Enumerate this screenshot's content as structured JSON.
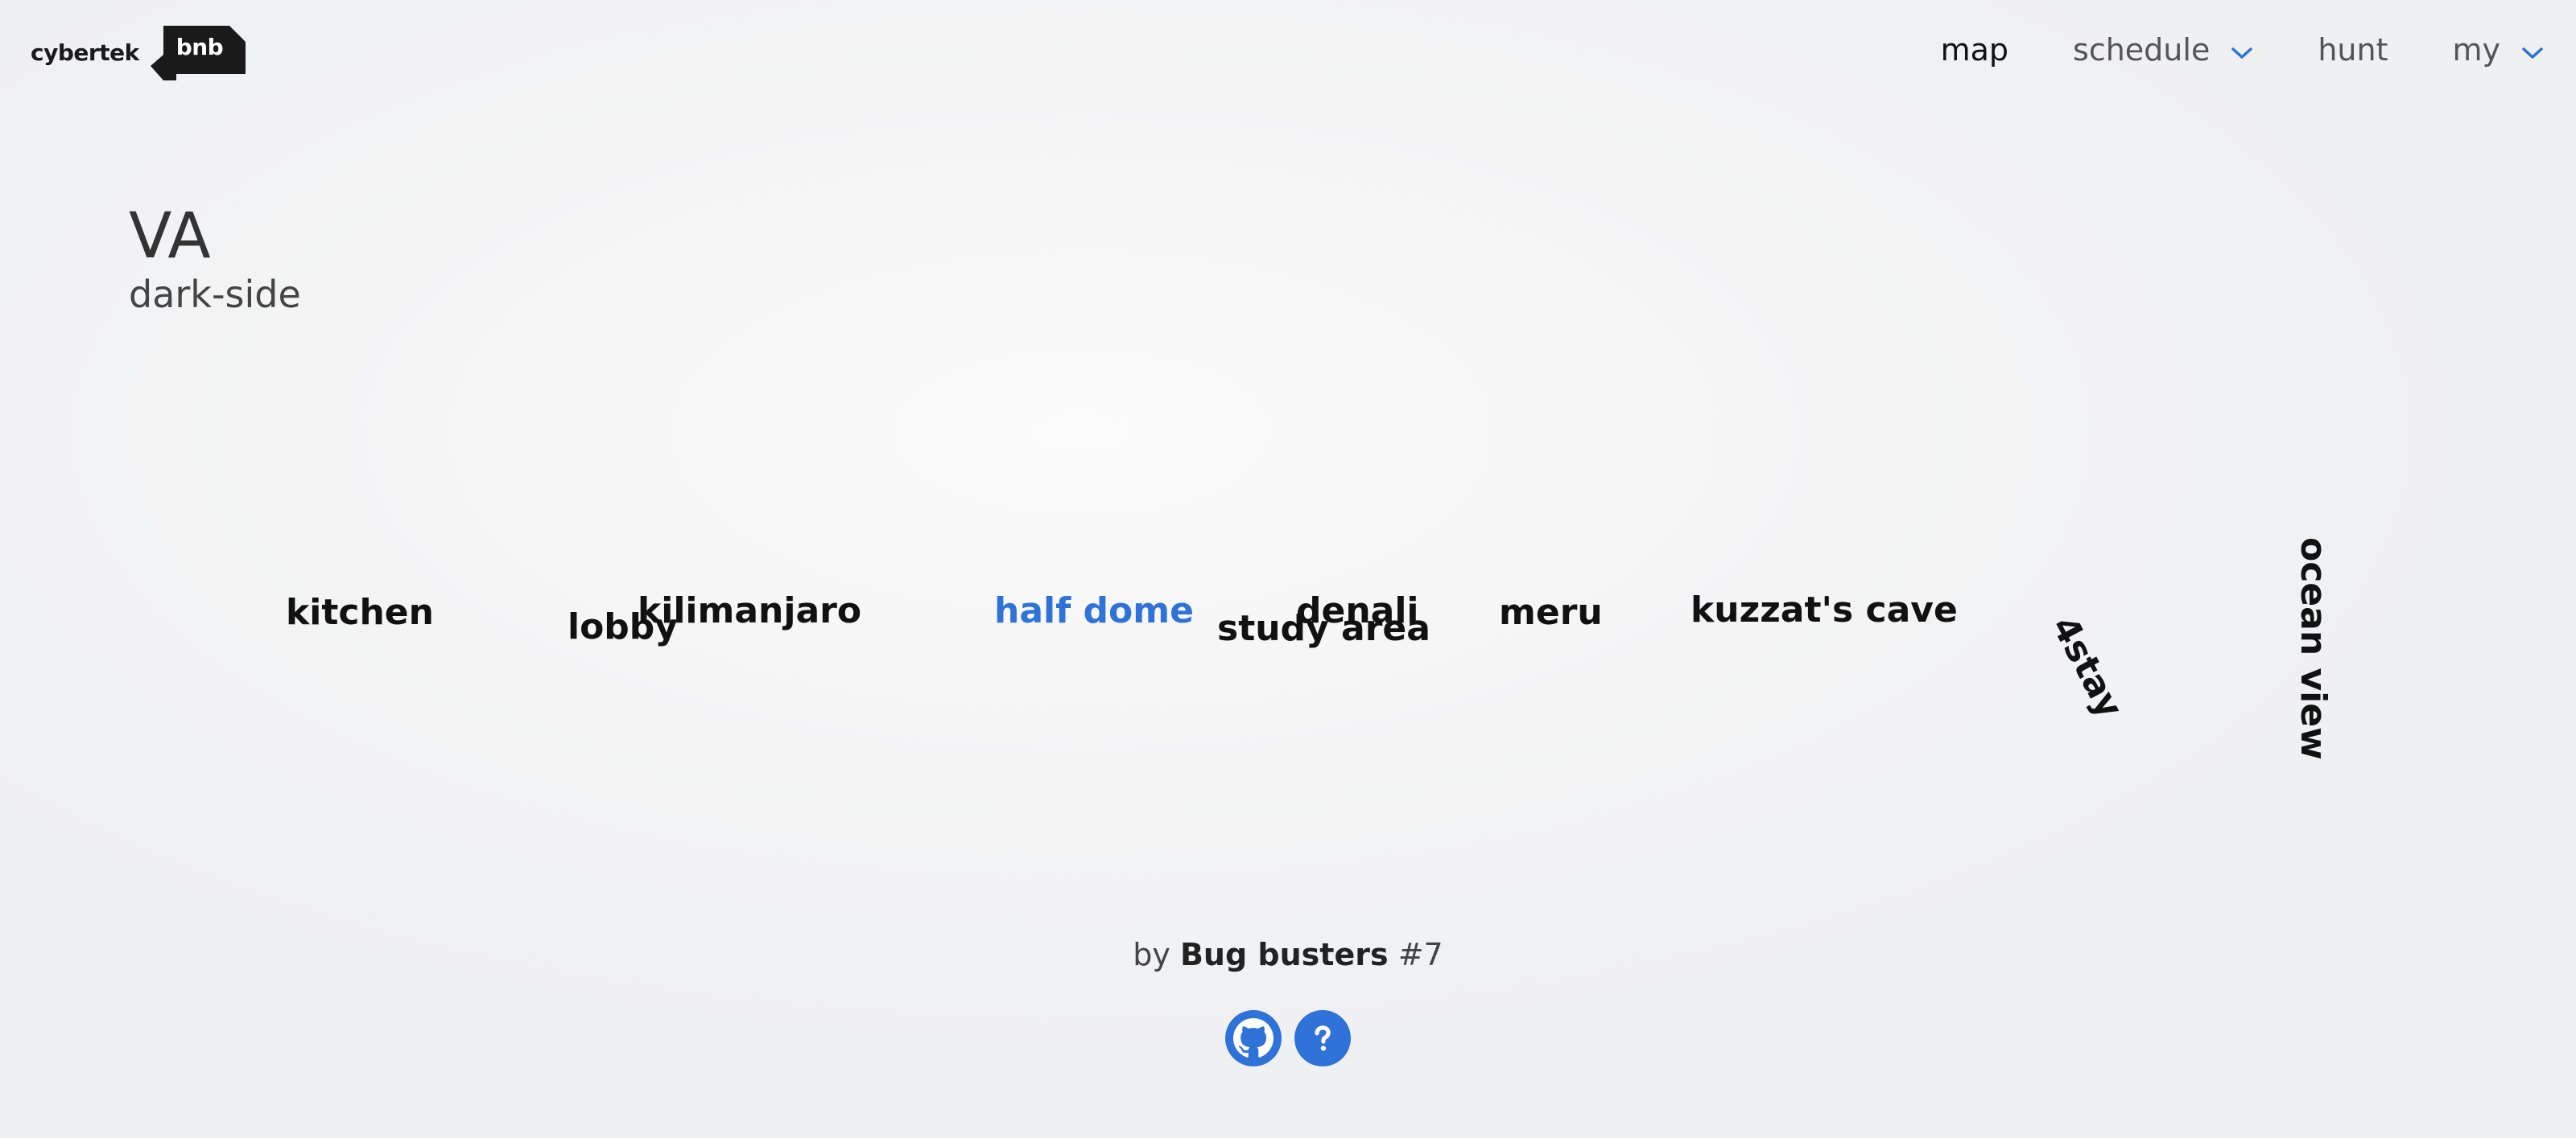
{
  "logo": {
    "word": "cybertek",
    "badge": "bnb"
  },
  "nav": {
    "map": "map",
    "schedule": "schedule",
    "hunt": "hunt",
    "my": "my"
  },
  "page": {
    "title": "VA",
    "subtitle": "dark-side"
  },
  "rooms": {
    "kitchen": "kitchen",
    "lobby": "lobby",
    "kilimanjaro": "kilimanjaro",
    "half_dome": "half dome",
    "study_area": "study area",
    "denali": "denali",
    "meru": "meru",
    "kuzzat": "kuzzat's cave",
    "four_stay": "4stay",
    "ocean_view": "ocean view"
  },
  "footer": {
    "by": "by",
    "team": "Bug busters",
    "number": "#7",
    "icons": [
      "github-icon",
      "help-icon"
    ]
  },
  "colors": {
    "accent": "#2f72d8",
    "text_dark": "#111111",
    "background": "#f4f4f5"
  }
}
